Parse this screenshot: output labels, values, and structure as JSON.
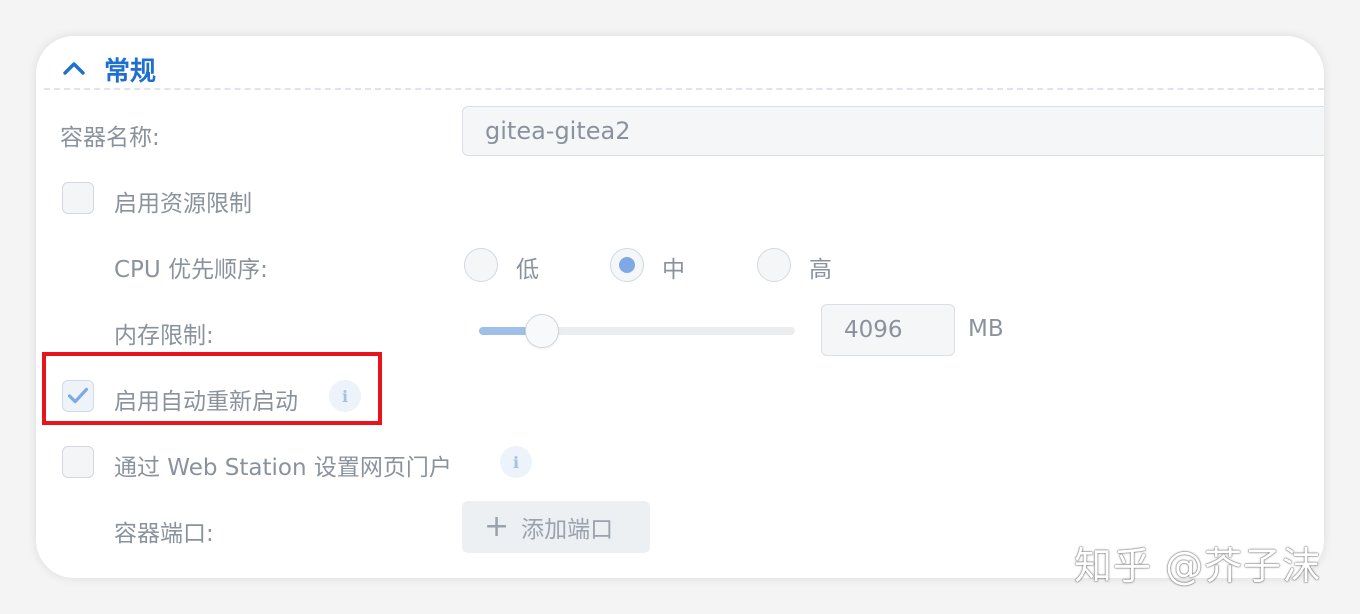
{
  "section": {
    "title": "常规",
    "expanded": true
  },
  "container_name": {
    "label": "容器名称:",
    "value": "gitea-gitea2"
  },
  "resource_limit": {
    "label": "启用资源限制",
    "checked": false
  },
  "cpu_priority": {
    "label": "CPU 优先顺序:",
    "options": [
      {
        "label": "低",
        "selected": false
      },
      {
        "label": "中",
        "selected": true
      },
      {
        "label": "高",
        "selected": false
      }
    ]
  },
  "memory_limit": {
    "label": "内存限制:",
    "value": "4096",
    "unit": "MB",
    "slider_fraction": 0.2
  },
  "auto_restart": {
    "label": "启用自动重新启动",
    "checked": true,
    "info_icon": "i"
  },
  "web_station": {
    "label": "通过 Web Station 设置网页门户",
    "checked": false,
    "info_icon": "i"
  },
  "container_port": {
    "label": "容器端口:",
    "add_button": "添加端口"
  },
  "watermark": "知乎 @芥子沫",
  "colors": {
    "accent": "#1f6fd1",
    "highlight": "#e8131b",
    "check": "#7fa9e6"
  }
}
